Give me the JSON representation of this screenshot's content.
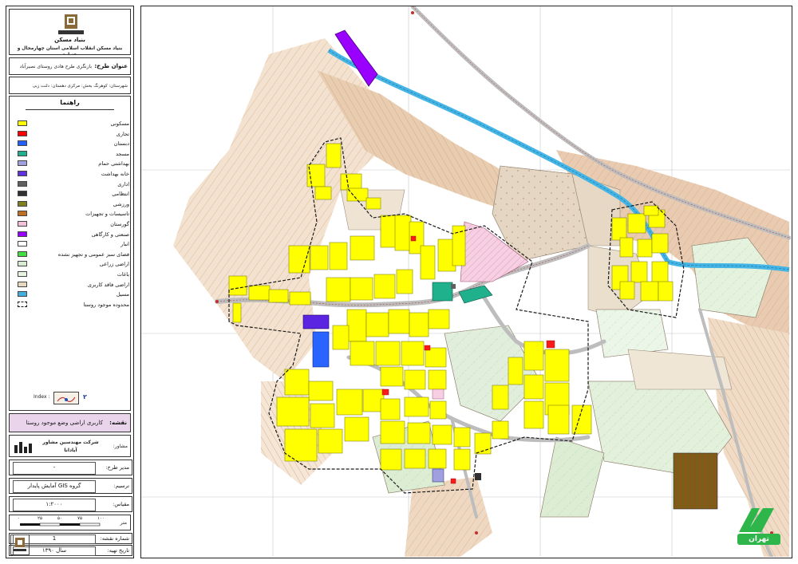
{
  "header": {
    "org_title": "بنیاد مسکن انقلاب اسلامی استان چهارمحال و بختیاری",
    "logo_text": "بنیاد مسکن"
  },
  "project": {
    "title_label": "عنوان طرح:",
    "title_value": "بازنگری طرح هادی روستای نصیرآباد",
    "location_line": "شهرستان: کوهرنگ   بخش: مرکزی   دهستان: دلنت زبی"
  },
  "legend": {
    "heading": "راهنما",
    "items": [
      {
        "label": "مسکونی",
        "color": "#ffff00"
      },
      {
        "label": "تجاری",
        "color": "#ff0000"
      },
      {
        "label": "دبستان",
        "color": "#2060ff"
      },
      {
        "label": "مسجد",
        "color": "#20b090"
      },
      {
        "label": "بهداشتی   حمام",
        "color": "#a0a0e0"
      },
      {
        "label": "خانه بهداشت",
        "color": "#6030e0"
      },
      {
        "label": "اداری",
        "color": "#606060"
      },
      {
        "label": "انتظامی",
        "color": "#303030"
      },
      {
        "label": "ورزشی",
        "color": "#808020"
      },
      {
        "label": "تاسیسات و تجهیزات",
        "color": "#c07020"
      },
      {
        "label": "گورستان",
        "color": "#f4c0d8"
      },
      {
        "label": "صنعتی و کارگاهی",
        "color": "#9a00ff"
      },
      {
        "label": "انبار",
        "color": "#ffffff"
      },
      {
        "label": "فضای سبز عمومی و تجهیز نشده",
        "color": "#40e040"
      },
      {
        "label": "اراضی زراعی",
        "color": "#d8ecd0"
      },
      {
        "label": "باغات",
        "color": "#e8f4e0"
      },
      {
        "label": "اراضی فاقد کاربری",
        "color": "#e8d8c0"
      },
      {
        "label": "مسیل",
        "color": "#40b0e0"
      },
      {
        "label": "محدوده موجود روستا",
        "color": "#ffffff"
      }
    ],
    "index_label": "Index :",
    "index_number": "۲"
  },
  "map_title": {
    "label": "نقشه:",
    "value": "کاربری اراضی وضع موجود روستا"
  },
  "consultant": {
    "label": "مشاور:",
    "company": "شرکت مهندسین مشاور",
    "company2": "آیادانا"
  },
  "fields": {
    "manager_label": "مدیر طرح:",
    "manager_value": "-",
    "drafter_label": "ترسیم:",
    "drafter_value": "گروه GIS آمایش پایدار",
    "scale_label": "مقیاس:",
    "scale_value": "۱:۲۰۰۰"
  },
  "scalebar": {
    "ticks": [
      "۰",
      "۲۵",
      "۵۰",
      "۷۵",
      "۱۰۰"
    ],
    "unit": "متر"
  },
  "footer": {
    "sheet_label": "شماره نقشه:",
    "sheet_value": "1",
    "date_label": "تاریخ تهیه:",
    "date_value": "سال ۱۳۹۰"
  },
  "colors": {
    "residential": "#ffff00",
    "road": "#d8d8d8",
    "river": "#45b5e5",
    "slope": "#e8d0b8",
    "agri": "#dcefd6",
    "boundary": "#1a1a1a"
  },
  "watermark_text": "تهران"
}
